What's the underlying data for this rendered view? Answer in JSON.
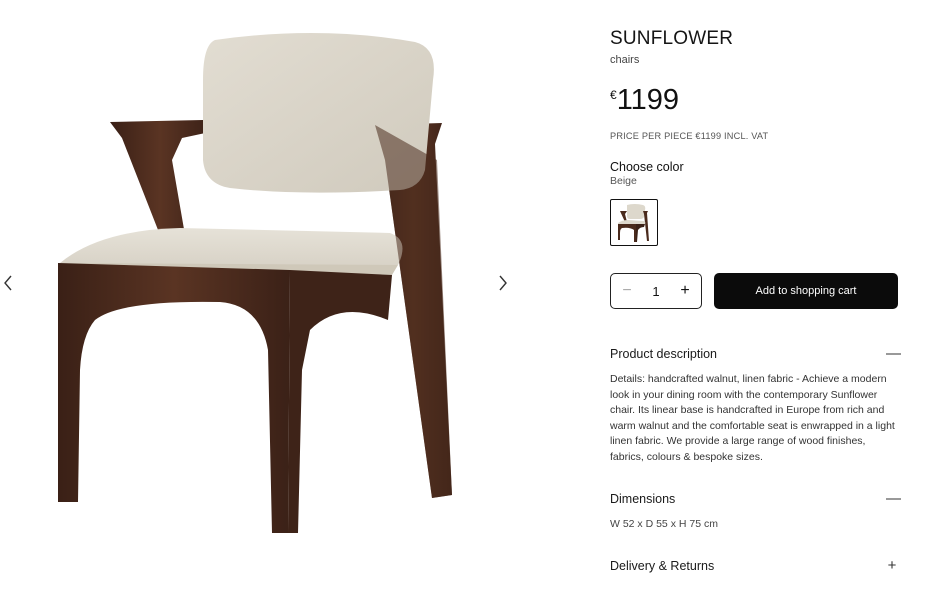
{
  "product": {
    "name": "SUNFLOWER",
    "category": "chairs",
    "currency_symbol": "€",
    "price": "1199",
    "price_note": "PRICE PER PIECE €1199 INCL. VAT"
  },
  "color": {
    "label": "Choose color",
    "selected": "Beige",
    "swatch_icon": "chair-thumbnail"
  },
  "quantity": {
    "value": "1",
    "minus_icon": "minus-icon",
    "plus_icon": "plus-icon"
  },
  "cart": {
    "button_label": "Add to shopping cart"
  },
  "sections": {
    "description": {
      "label": "Product description",
      "state": "expanded",
      "toggle_glyph": "—",
      "text": "Details: handcrafted walnut, linen fabric - Achieve a modern look in your dining room with the contemporary Sunflower chair. Its linear base is handcrafted in Europe from rich and warm walnut and the comfortable seat is enwrapped in a light linen fabric. We provide a large range of wood finishes, fabrics, colours & bespoke sizes."
    },
    "dimensions": {
      "label": "Dimensions",
      "state": "expanded",
      "toggle_glyph": "—",
      "text": "W 52 x D 55 x H 75 cm"
    },
    "delivery": {
      "label": "Delivery & Returns",
      "state": "collapsed",
      "toggle_glyph": "+"
    }
  },
  "gallery": {
    "prev_icon": "chevron-left-icon",
    "next_icon": "chevron-right-icon"
  },
  "colors": {
    "walnut": "#4a2a1c",
    "linen": "#e3ded3",
    "button_bg": "#0b0b0b"
  }
}
